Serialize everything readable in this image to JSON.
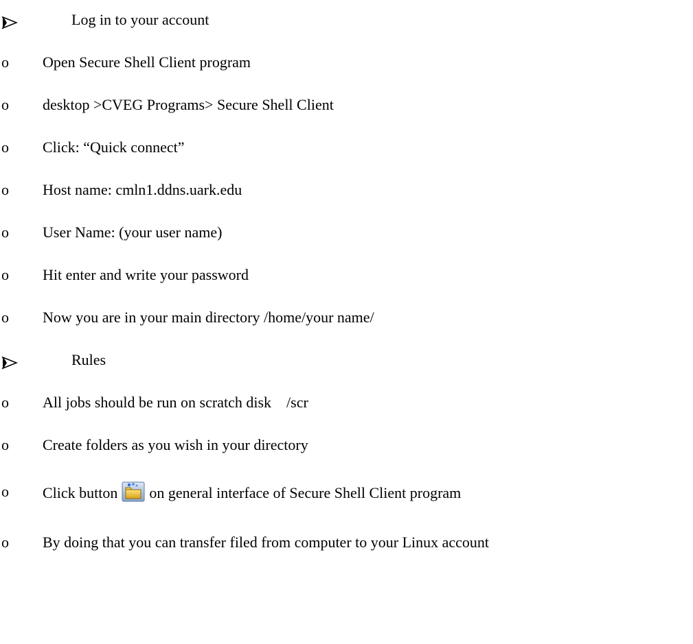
{
  "sections": [
    {
      "heading": "Log in to your account",
      "items": [
        "Open Secure Shell Client program",
        "desktop >CVEG Programs> Secure Shell Client",
        "Click: “Quick connect”",
        "Host name: cmln1.ddns.uark.edu",
        "User Name: (your user name)",
        "Hit enter and write your password",
        "Now you are in your main directory /home/your name/"
      ]
    },
    {
      "heading": "Rules",
      "items": [
        "All jobs should be run on scratch disk    /scr",
        "Create folders as you wish in your directory"
      ],
      "icon_item": {
        "before": "Click button",
        "icon": "file-transfer-icon",
        "after": "on general interface of Secure Shell Client program"
      },
      "items_after": [
        "By doing that you can transfer filed from computer to your Linux account"
      ]
    }
  ],
  "markers": {
    "heading": "arrow-bullet",
    "item": "o"
  }
}
